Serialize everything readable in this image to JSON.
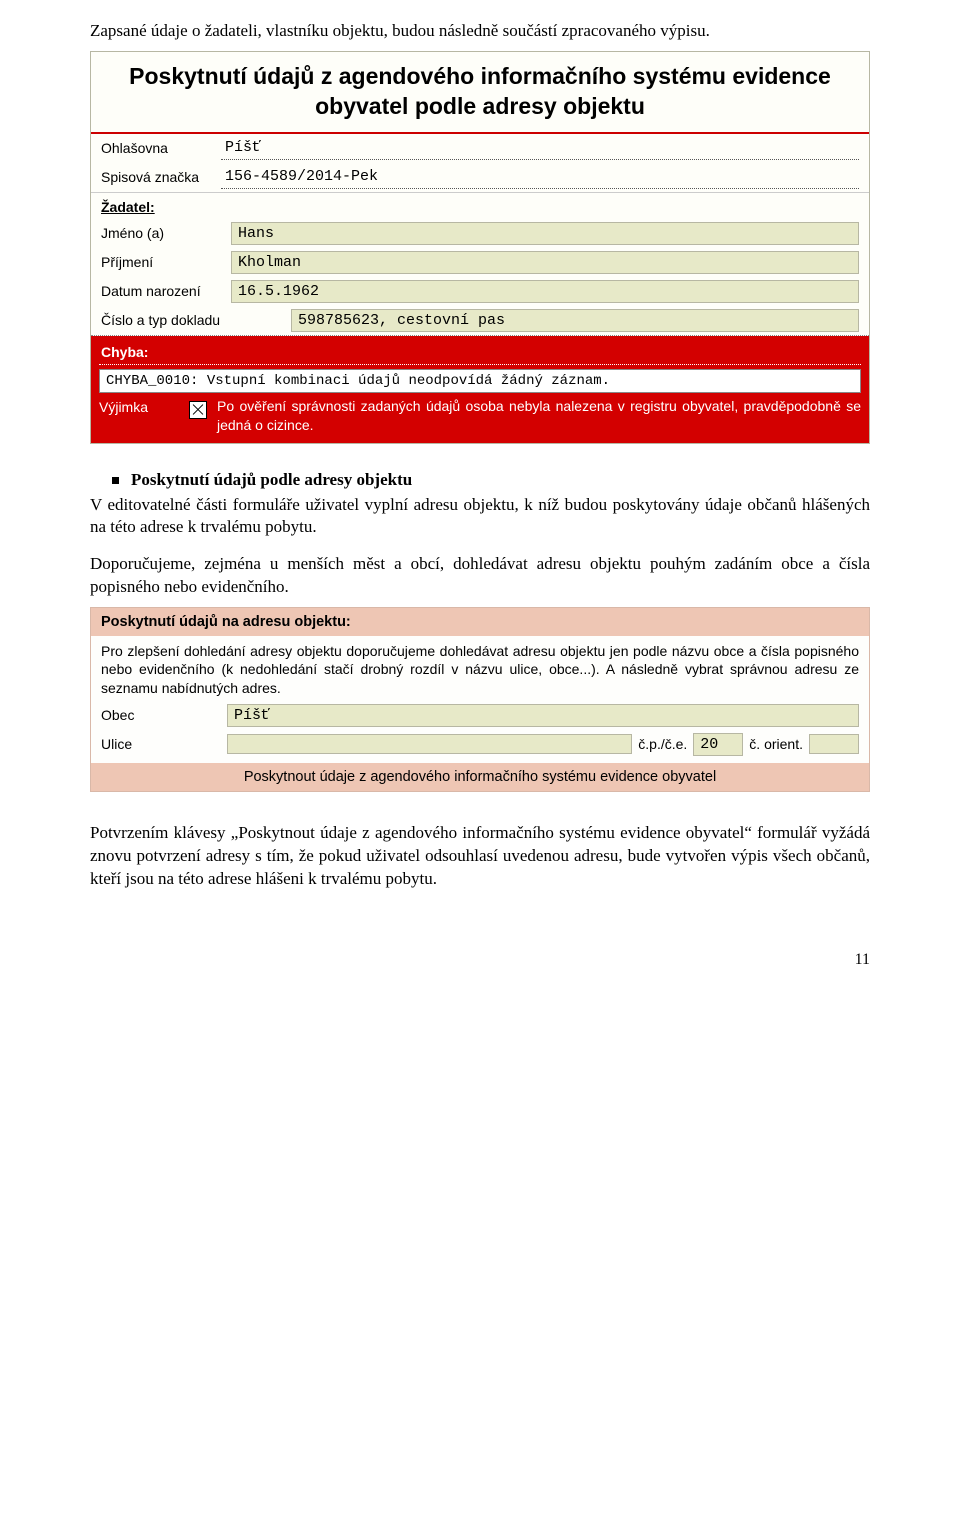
{
  "intro": "Zapsané údaje o žadateli, vlastníku objektu, budou následně součástí zpracovaného výpisu.",
  "form1": {
    "title": "Poskytnutí údajů z agendového informačního systému evidence obyvatel podle adresy objektu",
    "ohlasovna_label": "Ohlašovna",
    "ohlasovna_value": "Píšť",
    "spisova_label": "Spisová značka",
    "spisova_value": "156-4589/2014-Pek",
    "zadatel_head": "Žadatel:",
    "jmeno_label": "Jméno (a)",
    "jmeno_value": "Hans",
    "prijmeni_label": "Příjmení",
    "prijmeni_value": "Kholman",
    "datum_label": "Datum narození",
    "datum_value": "16.5.1962",
    "doklad_label": "Číslo a typ dokladu",
    "doklad_value": "598785623, cestovní pas",
    "chyba_label": "Chyba:",
    "chyba_msg": "CHYBA_0010: Vstupní kombinaci údajů neodpovídá žádný záznam.",
    "vyjimka_label": "Výjimka",
    "vyjimka_text": "Po ověření správnosti zadaných údajů osoba nebyla nalezena v registru obyvatel, pravděpodobně se jedná o cizince."
  },
  "bullet1": "Poskytnutí údajů podle adresy objektu",
  "para1": "V editovatelné části formuláře uživatel vyplní adresu objektu, k níž budou poskytovány údaje občanů hlášených na této adrese k trvalému pobytu.",
  "para2": "Doporučujeme, zejména u menších měst a obcí, dohledávat adresu objektu pouhým zadáním obce a čísla popisného nebo evidenčního.",
  "form2": {
    "head": "Poskytnutí údajů na adresu objektu:",
    "info": "Pro zlepšení dohledání adresy objektu doporučujeme dohledávat adresu objektu jen podle názvu obce a čísla popisného nebo evidenčního (k nedohledání stačí drobný rozdíl v názvu ulice, obce...). A následně vybrat správnou adresu ze seznamu nabídnutých adres.",
    "obec_label": "Obec",
    "obec_value": "Píšť",
    "ulice_label": "Ulice",
    "ulice_value": "",
    "cp_label": "č.p./č.e.",
    "cp_value": "20",
    "orient_label": "č. orient.",
    "orient_value": "",
    "submit": "Poskytnout údaje z agendového informačního systému evidence obyvatel"
  },
  "para3": "Potvrzením klávesy „Poskytnout údaje z agendového informačního systému evidence obyvatel“ formulář vyžádá znovu potvrzení adresy s tím, že pokud uživatel odsouhlasí uvedenou adresu, bude vytvořen výpis všech občanů, kteří jsou na této adrese hlášeni k trvalému pobytu.",
  "page_number": "11"
}
